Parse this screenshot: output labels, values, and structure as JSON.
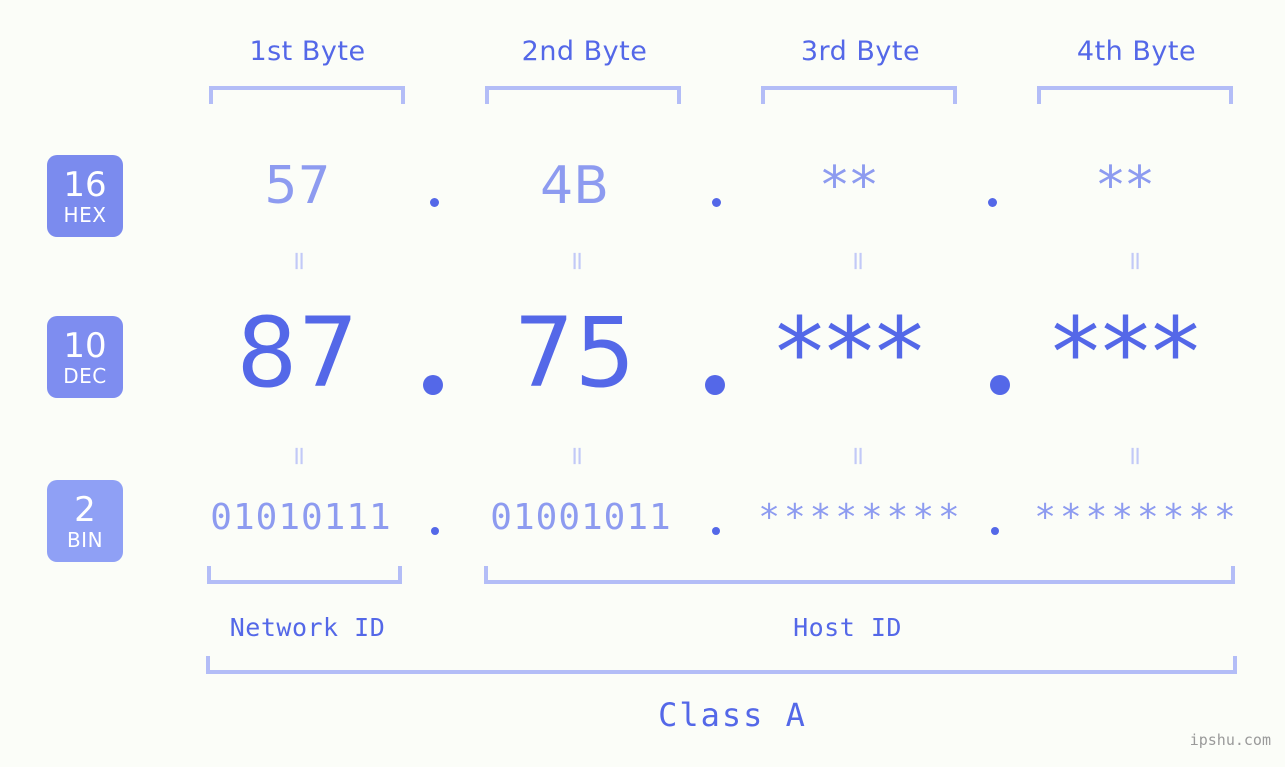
{
  "background_color": "#fbfdf8",
  "colors": {
    "accent_strong": "#5468e8",
    "accent_light": "#8d9bf0",
    "bracket": "#b3bdf7",
    "equals": "#c2c9f7",
    "badge_hex": "#7b8bee",
    "badge_dec": "#7e8df0",
    "badge_bin": "#8fa0f5",
    "watermark": "#9a9a9a"
  },
  "headers": [
    {
      "label": "1st Byte"
    },
    {
      "label": "2nd Byte"
    },
    {
      "label": "3rd Byte"
    },
    {
      "label": "4th Byte"
    }
  ],
  "bases": [
    {
      "num": "16",
      "name": "HEX"
    },
    {
      "num": "10",
      "name": "DEC"
    },
    {
      "num": "2",
      "name": "BIN"
    }
  ],
  "rows": {
    "hex": {
      "values": [
        "57",
        "4B",
        "**",
        "**"
      ]
    },
    "dec": {
      "values": [
        "87",
        "75",
        "***",
        "***"
      ]
    },
    "bin": {
      "values": [
        "01010111",
        "01001011",
        "********",
        "********"
      ]
    }
  },
  "separator": ".",
  "equals_symbol": "=",
  "footer": {
    "network_id": "Network ID",
    "host_id": "Host ID",
    "class": "Class A"
  },
  "watermark": "ipshu.com"
}
